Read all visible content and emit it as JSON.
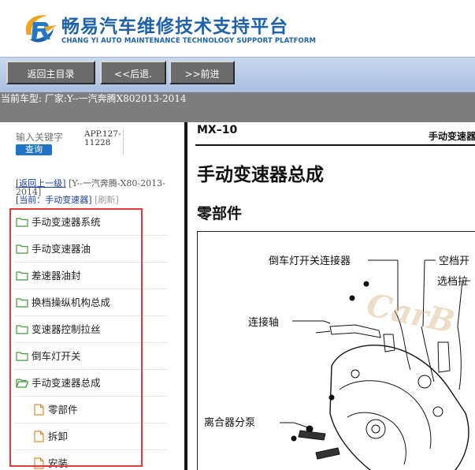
{
  "header": {
    "title": "畅易汽车维修技术支持平台",
    "subtitle": "CHANG YI AUTO MAINTENANCE TECHNOLOGY SUPPORT PLATFORM",
    "logo_icon": "cy-swoosh-logo-icon"
  },
  "navbar": {
    "buttons": [
      {
        "label": "返回主目录"
      },
      {
        "label": "<<后退."
      },
      {
        "label": ">>前进"
      }
    ]
  },
  "vehicle_info": "当前车型:  厂家:Y--一汽奔腾X802013-2014",
  "sidebar": {
    "search_placeholder": "输入关键字",
    "search_button": "查询",
    "app_version": "APP.127-11228",
    "breadcrumb": {
      "back_link": "[返回上一级]",
      "parent": "[Y--一汽奔腾-X80-2013-2014]",
      "current": "[当前：手动变速器]",
      "refresh": "[刷新]"
    },
    "tree": [
      {
        "label": "手动变速器系统",
        "icon": "folder-icon"
      },
      {
        "label": "手动变速器油",
        "icon": "folder-icon"
      },
      {
        "label": "差速器油封",
        "icon": "folder-icon"
      },
      {
        "label": "换档操纵机构总成",
        "icon": "folder-icon"
      },
      {
        "label": "变速器控制拉丝",
        "icon": "folder-icon"
      },
      {
        "label": "倒车灯开关",
        "icon": "folder-icon"
      },
      {
        "label": "手动变速器总成",
        "icon": "folder-open-icon"
      },
      {
        "label": "零部件",
        "icon": "document-icon"
      },
      {
        "label": "拆卸",
        "icon": "document-icon"
      },
      {
        "label": "安装",
        "icon": "document-icon"
      }
    ]
  },
  "document": {
    "code": "MX–10",
    "section": "手动变速器",
    "title": "手动变速器总成",
    "subtitle": "零部件",
    "callouts": [
      {
        "label": "倒车灯开关连接器"
      },
      {
        "label": "空档开"
      },
      {
        "label": "选档拉"
      },
      {
        "label": "连接轴"
      },
      {
        "label": "离合器分泵"
      }
    ],
    "watermark": "CarB"
  },
  "colors": {
    "brand_blue": "#1d62ab",
    "nav_button_gray": "#6b6b6b",
    "info_bar_gray": "#7d7d7d",
    "highlight_red": "#e23b3b",
    "folder_green": "#3f9a3a",
    "doc_orange": "#e08a2c"
  }
}
